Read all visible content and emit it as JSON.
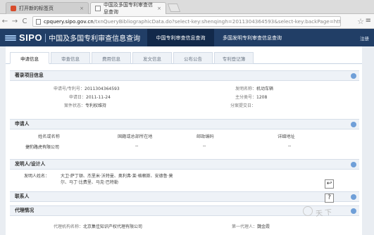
{
  "browser": {
    "tabs": [
      {
        "label": "打开新的标签页",
        "active": false
      },
      {
        "label": "中国及多国专利审查信息查询",
        "active": true
      }
    ],
    "tab_close": "×",
    "url_host": "cpquery.sipo.gov.cn",
    "url_path": "/txnQueryBibliographicData.do?select-key:shenqingh=2011304364593&select-key:backPage=http%3A%2F%2Fc...",
    "back": "←",
    "forward": "→",
    "reload": "C",
    "star": "☆",
    "menu": "≡"
  },
  "header": {
    "logo_text": "SIPO",
    "logo_cn": "中国及多国专利审查信息查询",
    "nav": [
      "中国专利审查信息查询",
      "多国发明专利审查信息查询"
    ],
    "login": "注册"
  },
  "subtabs": [
    "申请信息",
    "审查信息",
    "费用信息",
    "发文信息",
    "公布公告",
    "专利登记簿"
  ],
  "application_info": {
    "title": "著录项目信息",
    "app_no_label": "申请号/专利号：",
    "app_no": "2011304364593",
    "app_date_label": "申请日：",
    "app_date": "2011-11-24",
    "status_label": "案件状态：",
    "status": "专利权维持",
    "invention_name_label": "发明名称：",
    "invention_name": "机动车辆",
    "main_class_label": "主分类号：",
    "main_class": "1208",
    "division_label": "分案提交日：",
    "division": ""
  },
  "applicant": {
    "title": "申请人",
    "columns": [
      "姓名或名称",
      "国籍或总部所在地",
      "邮政编码",
      "详细地址"
    ],
    "rows": [
      [
        "捷豹路虎有限公司",
        "--",
        "--",
        "--"
      ]
    ]
  },
  "inventor": {
    "title": "发明人/设计人",
    "label": "发明人姓名：",
    "line1": "大卫·萨丁顿、杰里米·沃特曼、奥利弗·莱·格赖斯、安德鲁·莫",
    "line2": "尔、马丁·比费里、马克·巴特勒"
  },
  "contact": {
    "title": "联系人"
  },
  "agency": {
    "title": "代理情况",
    "agency_label": "代理机构名称：",
    "agency_name": "北京集佳知识产权代理有限公司",
    "agent_label": "第一代理人：",
    "agent_name": "魏金霞"
  },
  "side_buttons": [
    "↩",
    "?"
  ],
  "watermark": "天 下"
}
